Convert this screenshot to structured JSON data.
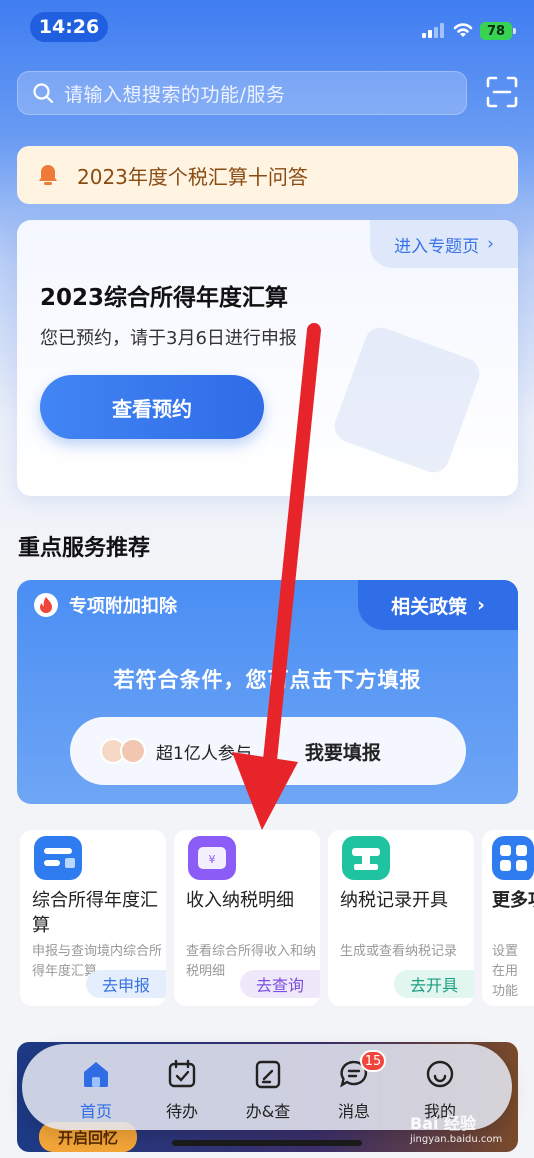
{
  "status_bar": {
    "time": "14:26",
    "battery": "78"
  },
  "search": {
    "placeholder": "请输入想搜索的功能/服务"
  },
  "notice": {
    "text": "2023年度个税汇算十问答"
  },
  "annual_card": {
    "tab_label": "进入专题页",
    "title": "2023综合所得年度汇算",
    "subtitle": "您已预约，请于3月6日进行申报",
    "button_label": "查看预约"
  },
  "section": {
    "title": "重点服务推荐"
  },
  "deduction_card": {
    "label": "专项附加扣除",
    "tab_label": "相关政策",
    "message": "若符合条件，您可点击下方填报",
    "participants": "超1亿人参与",
    "action_label": "我要填报"
  },
  "tiles": [
    {
      "name": "综合所得年度汇算",
      "desc": "申报与查询境内综合所得年度汇算",
      "tag": "去申报",
      "icon": "plus-list-icon",
      "color": "#2f7cf0",
      "tag_bg": "#e4eefc",
      "tag_color": "#3a73e6"
    },
    {
      "name": "收入纳税明细",
      "desc": "查看综合所得收入和纳税明细",
      "tag": "去查询",
      "icon": "wallet-yen-icon",
      "color": "#8b5cf6",
      "tag_bg": "#efe8fb",
      "tag_color": "#7b4fdb"
    },
    {
      "name": "纳税记录开具",
      "desc": "生成或查看纳税记录",
      "tag": "去开具",
      "icon": "stamp-icon",
      "color": "#1fc3a0",
      "tag_bg": "#e2f6f0",
      "tag_color": "#1a9f80"
    },
    {
      "name": "更多功",
      "desc": "设置在用功能",
      "tag": "",
      "icon": "grid-icon",
      "color": "#2f7cf0",
      "tag_bg": "#ffffff",
      "tag_color": "#3a73e6"
    }
  ],
  "banner": {
    "button_label": "开启回忆"
  },
  "bottom_nav": {
    "items": [
      {
        "label": "首页",
        "icon": "home-icon",
        "active": true
      },
      {
        "label": "待办",
        "icon": "calendar-check-icon",
        "active": false
      },
      {
        "label": "办&查",
        "icon": "edit-doc-icon",
        "active": false
      },
      {
        "label": "消息",
        "icon": "message-icon",
        "active": false,
        "badge": "15"
      },
      {
        "label": "我的",
        "icon": "smile-icon",
        "active": false
      }
    ]
  },
  "watermark": {
    "brand": "Bai 经验",
    "url": "jingyan.baidu.com"
  },
  "colors": {
    "accent": "#2f6ce6",
    "arrow": "#e8242b"
  }
}
